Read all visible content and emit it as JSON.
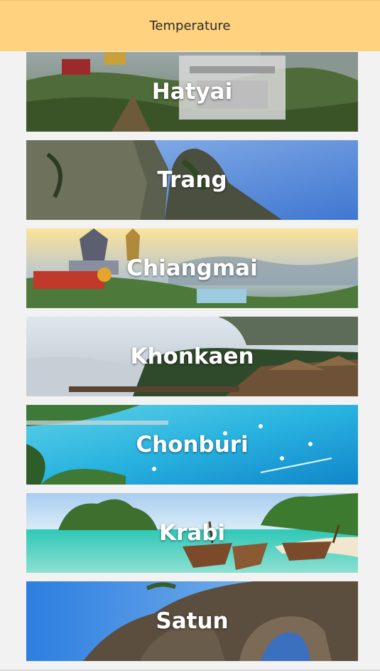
{
  "header": {
    "title": "Temperature",
    "color": "#ffd27f"
  },
  "cities": [
    {
      "name": "Hatyai",
      "image": "hilltop-temple-cable-car-photo"
    },
    {
      "name": "Trang",
      "image": "limestone-cliffs-photo"
    },
    {
      "name": "Chiangmai",
      "image": "twin-pagodas-garden-photo"
    },
    {
      "name": "Khonkaen",
      "image": "misty-lake-huts-photo"
    },
    {
      "name": "Chonburi",
      "image": "turquoise-bay-boats-photo"
    },
    {
      "name": "Krabi",
      "image": "longtail-boats-beach-photo"
    },
    {
      "name": "Satun",
      "image": "rock-arch-sea-photo"
    }
  ]
}
